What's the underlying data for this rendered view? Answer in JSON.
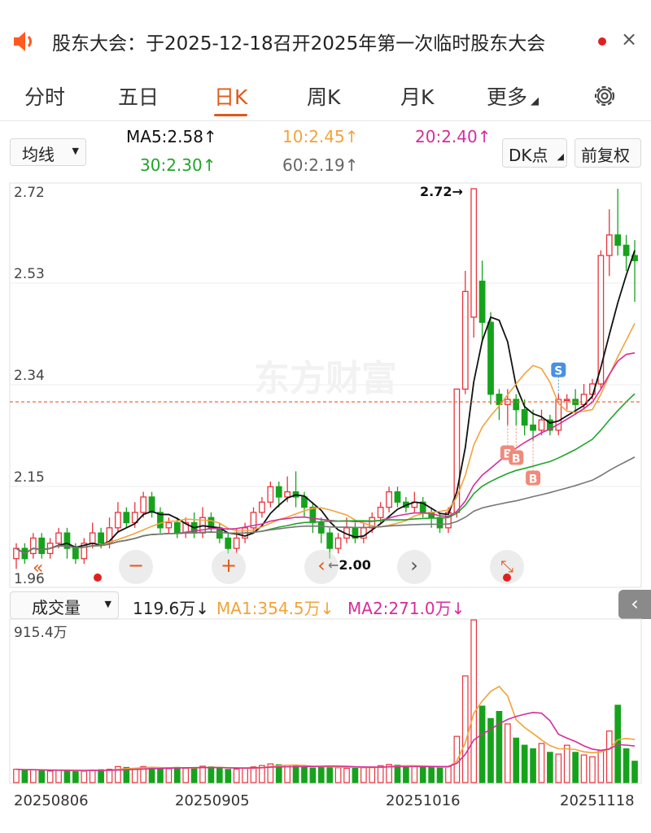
{
  "notice": {
    "text": "股东大会：于2025-12-18召开2025年第一次临时股东大会",
    "close": "×"
  },
  "tabs": [
    "分时",
    "五日",
    "日K",
    "周K",
    "月K",
    "更多"
  ],
  "controls": {
    "indicator_select": "均线",
    "dk_button": "DK点",
    "adjust_button": "前复权",
    "volume_select": "成交量"
  },
  "ma_legend": {
    "ma5": "MA5:2.58↑",
    "ma10": "10:2.45↑",
    "ma20": "20:2.40↑",
    "ma30": "30:2.30↑",
    "ma60": "60:2.19↑"
  },
  "volume_legend": {
    "vol": "119.6万↓",
    "ma1": "MA1:354.5万↓",
    "ma2": "MA2:271.0万↓"
  },
  "watermark": "东方财富",
  "colors": {
    "up": "#e8343c",
    "down": "#16a31c",
    "ma5": "#111111",
    "ma10": "#f2a33a",
    "ma20": "#d62d9c",
    "ma30": "#21a52a",
    "ma60": "#777777",
    "accent": "#e05a1a"
  },
  "chart_data": {
    "type": "candlestick",
    "price_axis": {
      "ticks": [
        "2.72",
        "2.53",
        "2.34",
        "2.15",
        "1.96"
      ],
      "min": 1.96,
      "max": 2.72
    },
    "volume_axis": {
      "max_label": "915.4万"
    },
    "x_labels": [
      "20250806",
      "20250905",
      "20251016",
      "20251118"
    ],
    "annotations": {
      "high": "2.72→",
      "low": "←2.00",
      "signals": [
        "S",
        "B",
        "B",
        "B"
      ]
    },
    "candles": [
      [
        2.0,
        2.02,
        1.98,
        2.03
      ],
      [
        2.02,
        2.0,
        1.99,
        2.03
      ],
      [
        2.01,
        2.04,
        2.0,
        2.05
      ],
      [
        2.04,
        2.01,
        2.0,
        2.05
      ],
      [
        2.01,
        2.03,
        2.0,
        2.04
      ],
      [
        2.03,
        2.05,
        2.02,
        2.06
      ],
      [
        2.05,
        2.02,
        2.0,
        2.06
      ],
      [
        2.02,
        2.0,
        1.99,
        2.03
      ],
      [
        2.0,
        2.03,
        1.99,
        2.04
      ],
      [
        2.03,
        2.05,
        2.02,
        2.07
      ],
      [
        2.05,
        2.03,
        2.02,
        2.06
      ],
      [
        2.03,
        2.06,
        2.02,
        2.08
      ],
      [
        2.06,
        2.09,
        2.05,
        2.11
      ],
      [
        2.09,
        2.07,
        2.06,
        2.1
      ],
      [
        2.07,
        2.09,
        2.06,
        2.11
      ],
      [
        2.09,
        2.12,
        2.08,
        2.13
      ],
      [
        2.12,
        2.09,
        2.08,
        2.13
      ],
      [
        2.09,
        2.06,
        2.05,
        2.1
      ],
      [
        2.06,
        2.07,
        2.05,
        2.08
      ],
      [
        2.07,
        2.05,
        2.04,
        2.08
      ],
      [
        2.05,
        2.07,
        2.04,
        2.08
      ],
      [
        2.07,
        2.05,
        2.04,
        2.09
      ],
      [
        2.05,
        2.08,
        2.04,
        2.1
      ],
      [
        2.08,
        2.06,
        2.05,
        2.09
      ],
      [
        2.06,
        2.04,
        2.03,
        2.07
      ],
      [
        2.04,
        2.02,
        2.01,
        2.05
      ],
      [
        2.02,
        2.04,
        2.01,
        2.06
      ],
      [
        2.04,
        2.06,
        2.03,
        2.07
      ],
      [
        2.06,
        2.09,
        2.05,
        2.1
      ],
      [
        2.09,
        2.11,
        2.08,
        2.12
      ],
      [
        2.11,
        2.14,
        2.1,
        2.15
      ],
      [
        2.14,
        2.12,
        2.1,
        2.15
      ],
      [
        2.12,
        2.13,
        2.11,
        2.16
      ],
      [
        2.13,
        2.12,
        2.1,
        2.17
      ],
      [
        2.12,
        2.1,
        2.08,
        2.13
      ],
      [
        2.1,
        2.07,
        2.05,
        2.11
      ],
      [
        2.07,
        2.05,
        2.03,
        2.08
      ],
      [
        2.05,
        2.02,
        2.0,
        2.06
      ],
      [
        2.02,
        2.04,
        2.01,
        2.05
      ],
      [
        2.04,
        2.06,
        2.03,
        2.08
      ],
      [
        2.06,
        2.04,
        2.03,
        2.07
      ],
      [
        2.04,
        2.06,
        2.03,
        2.07
      ],
      [
        2.06,
        2.08,
        2.05,
        2.09
      ],
      [
        2.08,
        2.1,
        2.07,
        2.11
      ],
      [
        2.1,
        2.13,
        2.09,
        2.14
      ],
      [
        2.13,
        2.11,
        2.1,
        2.14
      ],
      [
        2.11,
        2.1,
        2.09,
        2.12
      ],
      [
        2.1,
        2.11,
        2.09,
        2.13
      ],
      [
        2.11,
        2.09,
        2.08,
        2.12
      ],
      [
        2.09,
        2.08,
        2.06,
        2.1
      ],
      [
        2.08,
        2.06,
        2.05,
        2.09
      ],
      [
        2.06,
        2.09,
        2.05,
        2.1
      ],
      [
        2.09,
        2.33,
        2.08,
        2.33
      ],
      [
        2.33,
        2.52,
        2.32,
        2.56
      ],
      [
        2.47,
        2.72,
        2.43,
        2.72
      ],
      [
        2.54,
        2.46,
        2.42,
        2.58
      ],
      [
        2.46,
        2.32,
        2.3,
        2.48
      ],
      [
        2.32,
        2.3,
        2.27,
        2.33
      ],
      [
        2.3,
        2.31,
        2.26,
        2.33
      ],
      [
        2.31,
        2.29,
        2.26,
        2.32
      ],
      [
        2.29,
        2.26,
        2.24,
        2.31
      ],
      [
        2.26,
        2.25,
        2.23,
        2.29
      ],
      [
        2.25,
        2.27,
        2.24,
        2.29
      ],
      [
        2.27,
        2.25,
        2.24,
        2.28
      ],
      [
        2.25,
        2.31,
        2.24,
        2.32
      ],
      [
        2.31,
        2.31,
        2.29,
        2.32
      ],
      [
        2.31,
        2.3,
        2.28,
        2.33
      ],
      [
        2.3,
        2.32,
        2.29,
        2.34
      ],
      [
        2.32,
        2.34,
        2.31,
        2.35
      ],
      [
        2.34,
        2.59,
        2.33,
        2.6
      ],
      [
        2.59,
        2.63,
        2.55,
        2.68
      ],
      [
        2.63,
        2.61,
        2.59,
        2.72
      ],
      [
        2.61,
        2.59,
        2.56,
        2.63
      ],
      [
        2.59,
        2.58,
        2.5,
        2.62
      ]
    ],
    "volumes": [
      75,
      70,
      72,
      68,
      65,
      70,
      68,
      66,
      64,
      70,
      72,
      75,
      90,
      85,
      80,
      90,
      86,
      82,
      78,
      85,
      80,
      84,
      92,
      88,
      80,
      74,
      76,
      82,
      88,
      96,
      105,
      100,
      98,
      94,
      86,
      82,
      90,
      92,
      84,
      80,
      86,
      84,
      88,
      95,
      102,
      98,
      92,
      90,
      86,
      84,
      82,
      90,
      260,
      600,
      915,
      430,
      360,
      400,
      330,
      250,
      210,
      190,
      220,
      170,
      160,
      210,
      170,
      155,
      145,
      180,
      290,
      435,
      190,
      120
    ]
  }
}
